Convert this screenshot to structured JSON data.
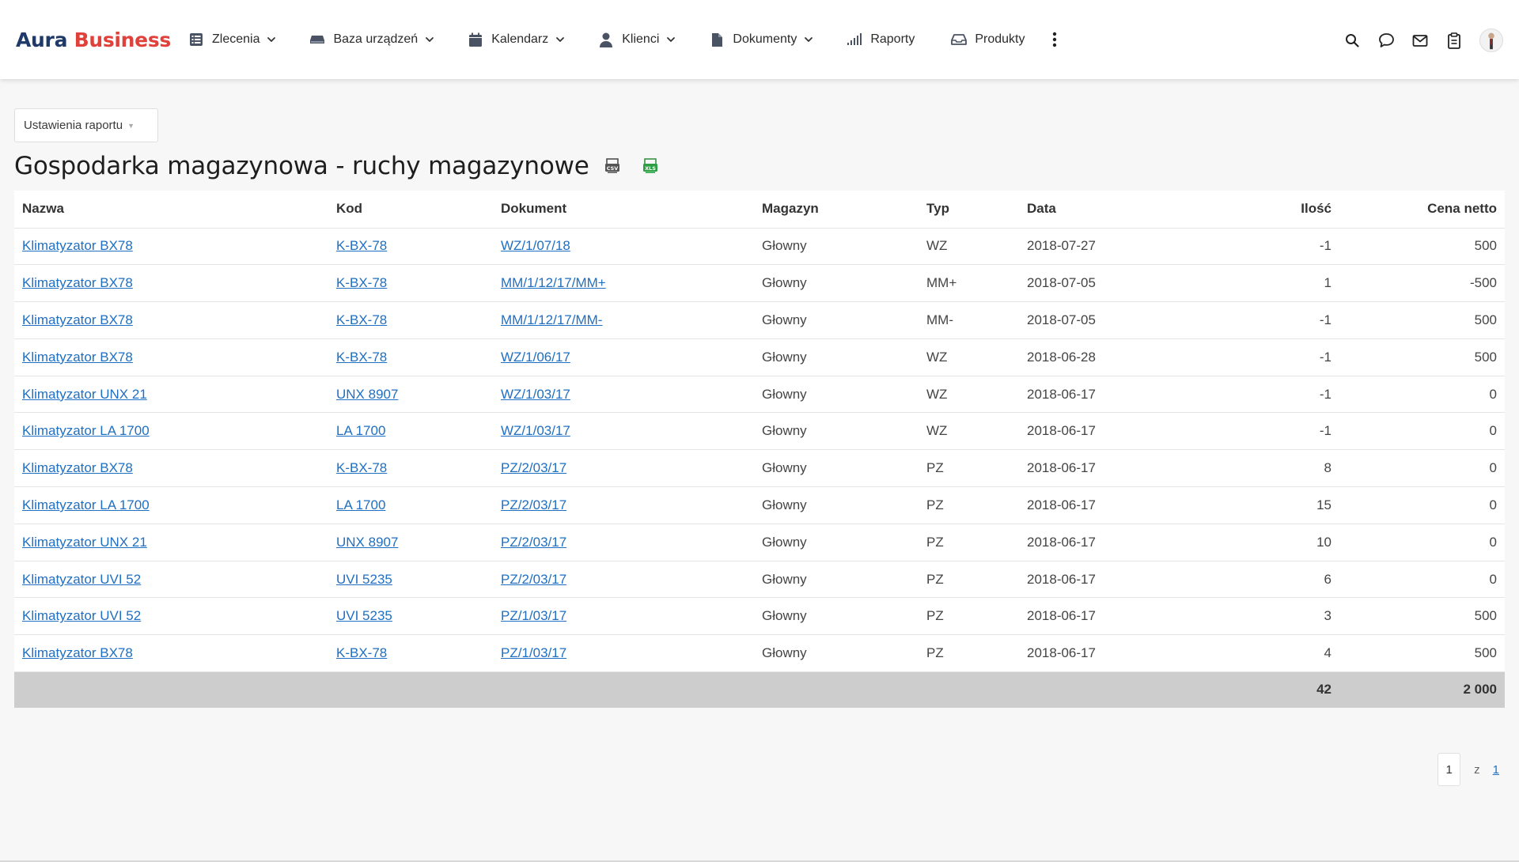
{
  "app": {
    "logo_part1": "Aura",
    "logo_part2": "Business",
    "brand_color_dark": "#1f3a68",
    "brand_color_red": "#e0413a"
  },
  "nav": {
    "items": [
      {
        "label": "Zlecenia",
        "icon": "list-icon",
        "dropdown": true
      },
      {
        "label": "Baza urządzeń",
        "icon": "device-icon",
        "dropdown": true
      },
      {
        "label": "Kalendarz",
        "icon": "calendar-icon",
        "dropdown": true
      },
      {
        "label": "Klienci",
        "icon": "user-icon",
        "dropdown": true
      },
      {
        "label": "Dokumenty",
        "icon": "document-icon",
        "dropdown": true
      },
      {
        "label": "Raporty",
        "icon": "signal-icon",
        "dropdown": false
      },
      {
        "label": "Produkty",
        "icon": "tray-icon",
        "dropdown": false
      }
    ],
    "more_icon": "kebab-icon"
  },
  "header_icons": [
    "search-icon",
    "chat-icon",
    "mail-icon",
    "clipboard-icon",
    "avatar"
  ],
  "report": {
    "settings_label": "Ustawienia raportu",
    "title": "Gospodarka magazynowa - ruchy magazynowe",
    "export_csv_icon": "csv-export-icon",
    "export_xls_icon": "xls-export-icon"
  },
  "table": {
    "columns": [
      "Nazwa",
      "Kod",
      "Dokument",
      "Magazyn",
      "Typ",
      "Data",
      "Ilość",
      "Cena netto"
    ],
    "rows": [
      {
        "nazwa": "Klimatyzator BX78",
        "kod": "K-BX-78",
        "dokument": "WZ/1/07/18",
        "magazyn": "Głowny",
        "typ": "WZ",
        "data": "2018-07-27",
        "ilosc": "-1",
        "cena": "500"
      },
      {
        "nazwa": "Klimatyzator BX78",
        "kod": "K-BX-78",
        "dokument": "MM/1/12/17/MM+",
        "magazyn": "Głowny",
        "typ": "MM+",
        "data": "2018-07-05",
        "ilosc": "1",
        "cena": "-500"
      },
      {
        "nazwa": "Klimatyzator BX78",
        "kod": "K-BX-78",
        "dokument": "MM/1/12/17/MM-",
        "magazyn": "Głowny",
        "typ": "MM-",
        "data": "2018-07-05",
        "ilosc": "-1",
        "cena": "500"
      },
      {
        "nazwa": "Klimatyzator BX78",
        "kod": "K-BX-78",
        "dokument": "WZ/1/06/17",
        "magazyn": "Głowny",
        "typ": "WZ",
        "data": "2018-06-28",
        "ilosc": "-1",
        "cena": "500"
      },
      {
        "nazwa": "Klimatyzator UNX 21",
        "kod": "UNX 8907",
        "dokument": "WZ/1/03/17",
        "magazyn": "Głowny",
        "typ": "WZ",
        "data": "2018-06-17",
        "ilosc": "-1",
        "cena": "0"
      },
      {
        "nazwa": "Klimatyzator LA 1700",
        "kod": "LA 1700",
        "dokument": "WZ/1/03/17",
        "magazyn": "Głowny",
        "typ": "WZ",
        "data": "2018-06-17",
        "ilosc": "-1",
        "cena": "0"
      },
      {
        "nazwa": "Klimatyzator BX78",
        "kod": "K-BX-78",
        "dokument": "PZ/2/03/17",
        "magazyn": "Głowny",
        "typ": "PZ",
        "data": "2018-06-17",
        "ilosc": "8",
        "cena": "0"
      },
      {
        "nazwa": "Klimatyzator LA 1700",
        "kod": "LA 1700",
        "dokument": "PZ/2/03/17",
        "magazyn": "Głowny",
        "typ": "PZ",
        "data": "2018-06-17",
        "ilosc": "15",
        "cena": "0"
      },
      {
        "nazwa": "Klimatyzator UNX 21",
        "kod": "UNX 8907",
        "dokument": "PZ/2/03/17",
        "magazyn": "Głowny",
        "typ": "PZ",
        "data": "2018-06-17",
        "ilosc": "10",
        "cena": "0"
      },
      {
        "nazwa": "Klimatyzator UVI 52",
        "kod": "UVI 5235",
        "dokument": "PZ/2/03/17",
        "magazyn": "Głowny",
        "typ": "PZ",
        "data": "2018-06-17",
        "ilosc": "6",
        "cena": "0"
      },
      {
        "nazwa": "Klimatyzator UVI 52",
        "kod": "UVI 5235",
        "dokument": "PZ/1/03/17",
        "magazyn": "Głowny",
        "typ": "PZ",
        "data": "2018-06-17",
        "ilosc": "3",
        "cena": "500"
      },
      {
        "nazwa": "Klimatyzator BX78",
        "kod": "K-BX-78",
        "dokument": "PZ/1/03/17",
        "magazyn": "Głowny",
        "typ": "PZ",
        "data": "2018-06-17",
        "ilosc": "4",
        "cena": "500"
      }
    ],
    "totals": {
      "ilosc": "42",
      "cena": "2 000"
    }
  },
  "pagination": {
    "current": "1",
    "of": "z",
    "total": "1"
  },
  "colors": {
    "link": "#1f6fc2",
    "summary_row": "#cdcdcd",
    "background": "#f7f7f7"
  }
}
